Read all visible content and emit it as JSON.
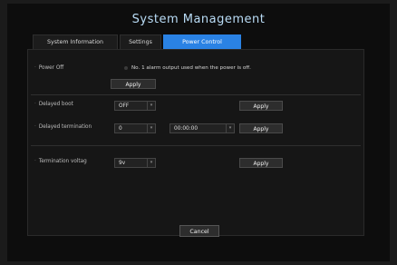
{
  "title": "System Management",
  "tabs": [
    {
      "label": "System Information"
    },
    {
      "label": "Settings"
    },
    {
      "label": "Power Control"
    }
  ],
  "power_off": {
    "label": "Power Off",
    "note": "No. 1 alarm output used when the power is off.",
    "apply_label": "Apply"
  },
  "delayed_boot": {
    "label": "Delayed boot",
    "value": "OFF",
    "apply_label": "Apply"
  },
  "delayed_termination": {
    "label": "Delayed termination",
    "value": "0",
    "time_value": "00:00:00",
    "apply_label": "Apply"
  },
  "termination_voltage": {
    "label": "Termination voltag",
    "value": "9v",
    "apply_label": "Apply"
  },
  "footer": {
    "cancel_label": "Cancel"
  },
  "colors": {
    "accent": "#2a82e4",
    "title": "#b9dcf6",
    "background": "#0d0d0d"
  },
  "icons": {
    "select_chevron": "chevron-down-icon",
    "radio": "radio-icon"
  }
}
